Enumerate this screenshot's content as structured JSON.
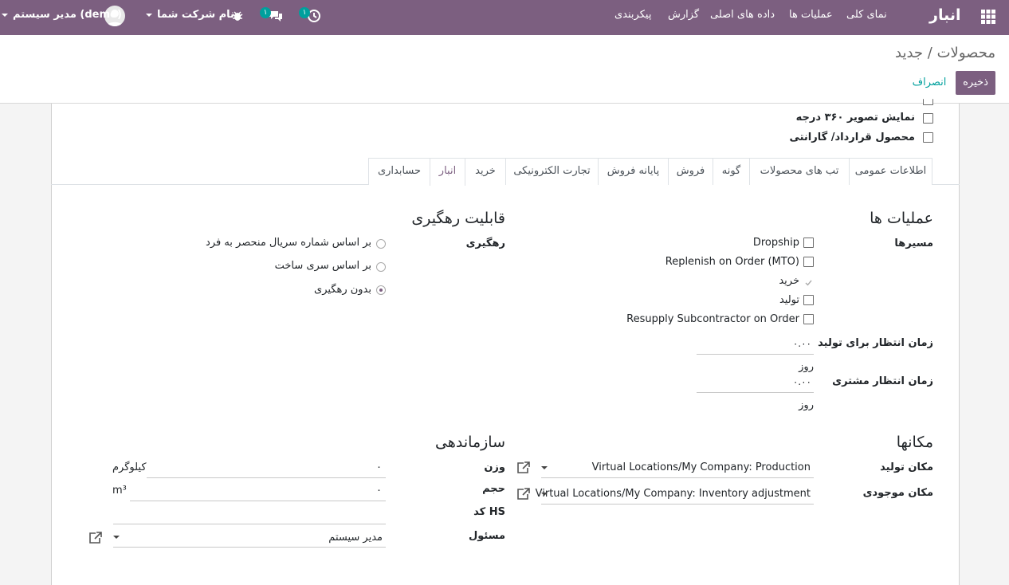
{
  "navbar": {
    "app_name": "انبار",
    "menu": [
      "نمای کلی",
      "عملیات ها",
      "داده های اصلی",
      "گزارش",
      "پیکربندی"
    ],
    "activity_count": "۱",
    "messages_count": "۱",
    "company": "نام شرکت شما",
    "user": "مدیر سیستم (demo)"
  },
  "control_panel": {
    "breadcrumb_root": "محصولات",
    "breadcrumb_sep": "/",
    "breadcrumb_current": "جدید",
    "save_label": "ذخیره",
    "discard_label": "انصراف"
  },
  "options": {
    "show_360": "نمایش تصویر ۳۶۰ درجه",
    "contract_warranty": "محصول قرارداد/ گارانتی"
  },
  "tabs": [
    "اطلاعات عمومی",
    "تب های محصولات",
    "گونه",
    "فروش",
    "پایانه فروش",
    "تجارت الکترونیکی",
    "خرید",
    "انبار",
    "حسابداری"
  ],
  "active_tab": "انبار",
  "operations": {
    "title": "عملیات ها",
    "routes_label": "مسیرها",
    "routes": [
      {
        "label": "Dropship",
        "checked": false
      },
      {
        "label": "Replenish on Order (MTO)",
        "checked": false
      },
      {
        "label": "خرید",
        "checked": true
      },
      {
        "label": "تولید",
        "checked": false
      },
      {
        "label": "Resupply Subcontractor on Order",
        "checked": false
      }
    ],
    "manufacturing_lead_label": "زمان انتظار برای تولید",
    "manufacturing_lead_value": "۰.۰۰",
    "manufacturing_lead_unit": "روز",
    "customer_lead_label": "زمان انتظار مشتری",
    "customer_lead_value": "۰.۰۰",
    "customer_lead_unit": "روز"
  },
  "traceability": {
    "title": "قابلیت رهگیری",
    "tracking_label": "رهگیری",
    "options": [
      {
        "label": "بر اساس شماره سریال منحصر به فرد",
        "selected": false
      },
      {
        "label": "بر اساس سری ساخت",
        "selected": false
      },
      {
        "label": "بدون رهگیری",
        "selected": true
      }
    ]
  },
  "locations": {
    "title": "مکانها",
    "production_label": "مکان تولید",
    "production_value": "Virtual Locations/My Company: Production",
    "inventory_label": "مکان موجودی",
    "inventory_value": "Virtual Locations/My Company: Inventory adjustment"
  },
  "organization": {
    "title": "سازماندهی",
    "weight_label": "وزن",
    "weight_value": "۰",
    "weight_unit": "کیلوگرم",
    "volume_label": "حجم",
    "volume_value": "۰",
    "volume_unit": "m³",
    "hs_label": "کد HS",
    "responsible_label": "مسئول",
    "responsible_value": "مدیر سیستم"
  },
  "colors": {
    "brand": "#7c5f80",
    "badge": "#00a09d",
    "link": "#00a09d"
  }
}
